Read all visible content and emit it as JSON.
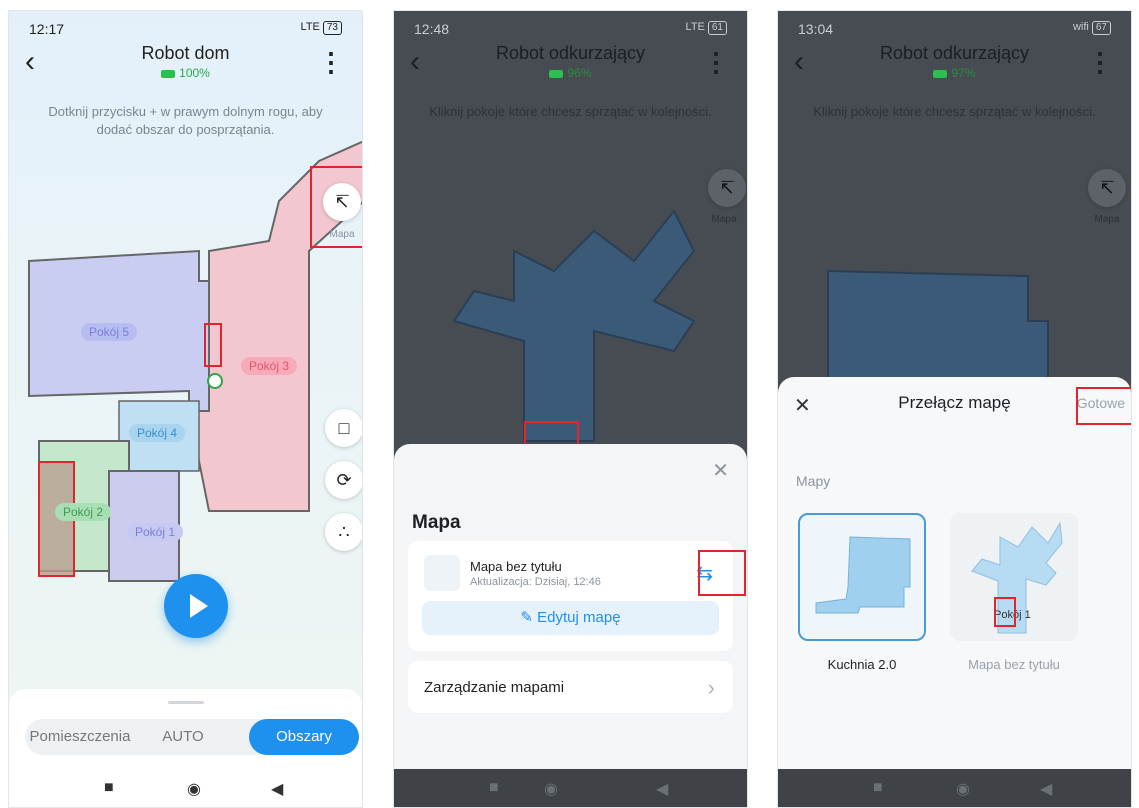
{
  "panel1": {
    "status": {
      "time": "12:17",
      "signal": "LTE",
      "battery": "73"
    },
    "header": {
      "title": "Robot dom",
      "battery": "100%"
    },
    "hint": "Dotknij przycisku + w prawym dolnym rogu, aby dodać obszar do posprzątania.",
    "map_button_label": "Mapa",
    "rooms": [
      "Pokój 5",
      "Pokój 3",
      "Pokój 4",
      "Pokój 2",
      "Pokój 1"
    ],
    "side_icons": [
      "add-area-icon",
      "repeat-3-icon",
      "suction-icon"
    ],
    "tabs": [
      "Pomieszczenia",
      "AUTO",
      "Obszary"
    ],
    "active_tab": "Obszary"
  },
  "panel2": {
    "status": {
      "time": "12:48",
      "signal": "LTE",
      "battery": "61"
    },
    "header": {
      "title": "Robot odkurzający",
      "battery": "96%"
    },
    "hint": "Kliknij pokoje które chcesz sprzątać w kolejności.",
    "map_button_label": "Mapa",
    "sheet": {
      "title": "Mapa",
      "map_name": "Mapa bez tytułu",
      "map_updated": "Aktualizacja: Dzisiaj, 12:46",
      "edit_label": "Edytuj mapę",
      "manage_label": "Zarządzanie mapami"
    }
  },
  "panel3": {
    "status": {
      "time": "13:04",
      "signal": "wifi",
      "battery": "67"
    },
    "header": {
      "title": "Robot odkurzający",
      "battery": "97%"
    },
    "hint": "Kliknij pokoje które chcesz sprzątać w kolejności.",
    "map_button_label": "Mapa",
    "sheet": {
      "title": "Przełącz mapę",
      "done_label": "Gotowe",
      "section": "Mapy",
      "maps": [
        "Kuchnia 2.0",
        "Mapa bez tytułu"
      ],
      "thumb_room": "Pokój 1"
    }
  },
  "colors": {
    "accent": "#1e90ee",
    "highlight": "#e0262d"
  }
}
